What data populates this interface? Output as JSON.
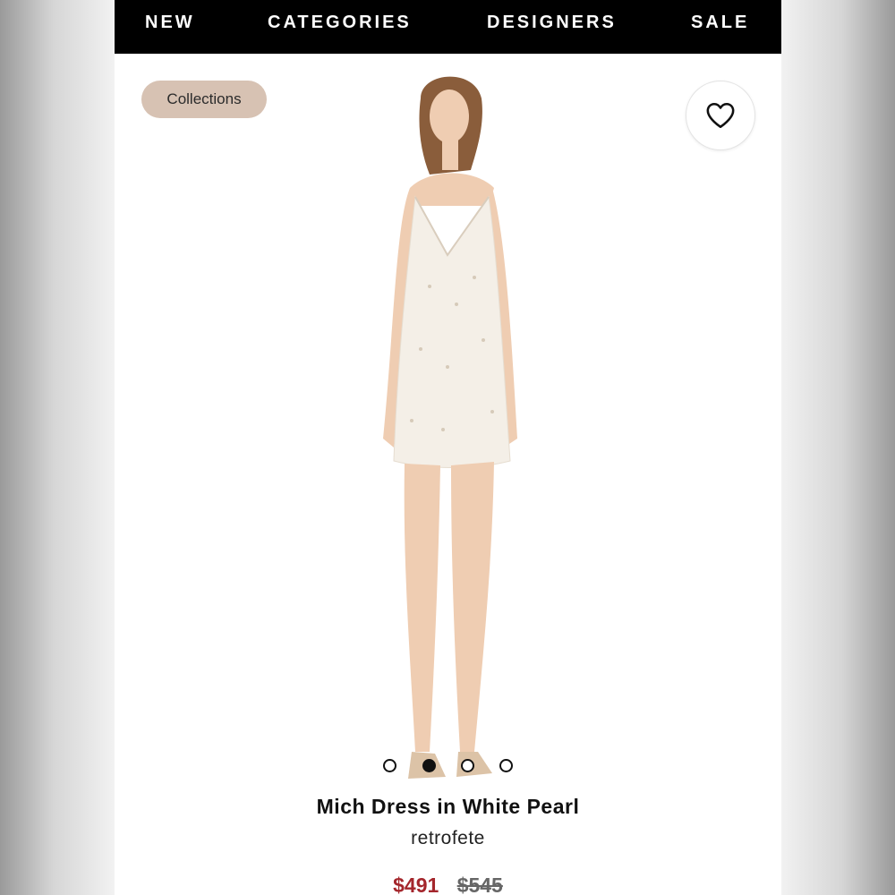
{
  "nav": {
    "items": [
      {
        "label": "NEW"
      },
      {
        "label": "CATEGORIES"
      },
      {
        "label": "DESIGNERS"
      },
      {
        "label": "SALE"
      }
    ]
  },
  "collections_chip": {
    "label": "Collections"
  },
  "favorite_button": {
    "icon": "heart-icon"
  },
  "carousel": {
    "slide_count": 4,
    "active_index": 1
  },
  "product": {
    "title": "Mich Dress in White Pearl",
    "brand": "retrofete",
    "sale_price": "$491",
    "original_price": "$545"
  },
  "colors": {
    "nav_bg": "#000000",
    "chip_bg": "#d7c2b3",
    "sale_price": "#a4262c"
  }
}
